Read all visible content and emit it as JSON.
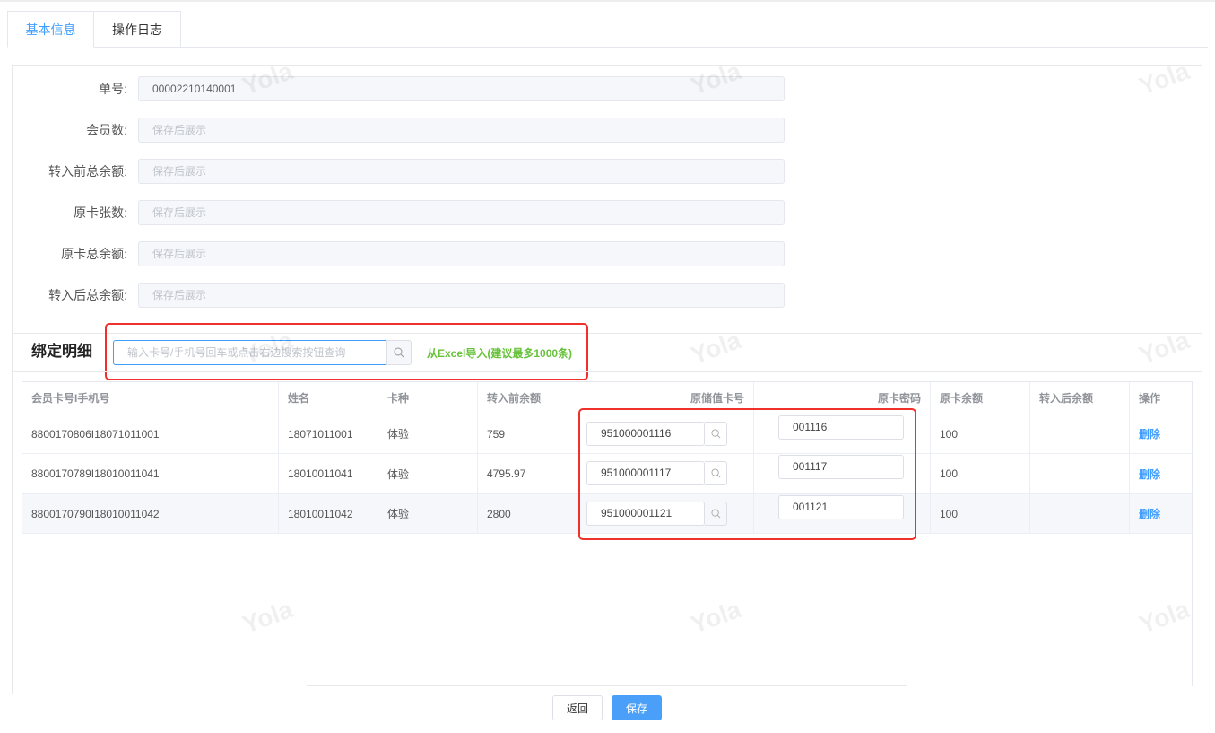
{
  "tabs": [
    {
      "label": "基本信息",
      "active": true
    },
    {
      "label": "操作日志",
      "active": false
    }
  ],
  "form": [
    {
      "label": "单号:",
      "value": "00002210140001",
      "placeholder": ""
    },
    {
      "label": "会员数:",
      "value": "",
      "placeholder": "保存后展示"
    },
    {
      "label": "转入前总余额:",
      "value": "",
      "placeholder": "保存后展示"
    },
    {
      "label": "原卡张数:",
      "value": "",
      "placeholder": "保存后展示"
    },
    {
      "label": "原卡总余额:",
      "value": "",
      "placeholder": "保存后展示"
    },
    {
      "label": "转入后总余额:",
      "value": "",
      "placeholder": "保存后展示"
    }
  ],
  "section": {
    "title": "绑定明细",
    "search_placeholder": "输入卡号/手机号回车或点击右边搜索按钮查询",
    "excel_link": "从Excel导入(建议最多1000条)"
  },
  "table": {
    "headers": [
      "会员卡号I手机号",
      "姓名",
      "卡种",
      "转入前余额",
      "原储值卡号",
      "原卡密码",
      "原卡余额",
      "转入后余额",
      "操作"
    ],
    "rows": [
      {
        "member": "8800170806I18071011001",
        "name": "18071011001",
        "type": "体验",
        "before": "759",
        "card": "951000001116",
        "pwd": "001116",
        "balance": "100",
        "after": "",
        "action": "删除"
      },
      {
        "member": "8800170789I18010011041",
        "name": "18010011041",
        "type": "体验",
        "before": "4795.97",
        "card": "951000001117",
        "pwd": "001117",
        "balance": "100",
        "after": "",
        "action": "删除"
      },
      {
        "member": "8800170790I18010011042",
        "name": "18010011042",
        "type": "体验",
        "before": "2800",
        "card": "951000001121",
        "pwd": "001121",
        "balance": "100",
        "after": "",
        "action": "删除"
      }
    ]
  },
  "footer": {
    "back": "返回",
    "save": "保存"
  },
  "watermark": "Yola",
  "colors": {
    "primary": "#409eff",
    "success": "#67c23a",
    "highlight": "#f0302a"
  }
}
